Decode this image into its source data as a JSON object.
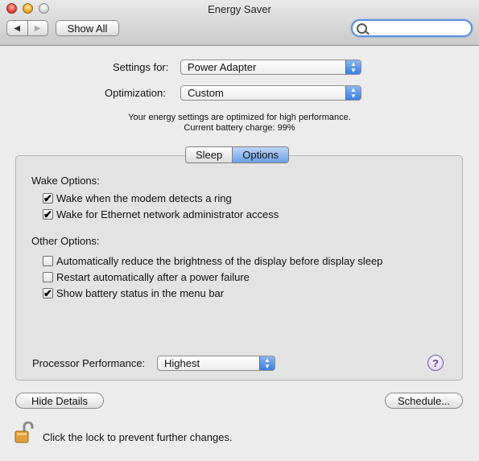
{
  "window": {
    "title": "Energy Saver"
  },
  "toolbar": {
    "show_all_label": "Show All",
    "back_glyph": "◀",
    "forward_glyph": "▶",
    "search_placeholder": ""
  },
  "settings": {
    "settings_for_label": "Settings for:",
    "settings_for_value": "Power Adapter",
    "optimization_label": "Optimization:",
    "optimization_value": "Custom",
    "note_line1": "Your energy settings are optimized for high performance.",
    "note_line2": "Current battery charge: 99%"
  },
  "tabs": [
    {
      "label": "Sleep",
      "active": false
    },
    {
      "label": "Options",
      "active": true
    }
  ],
  "wake_options": {
    "heading": "Wake Options:",
    "items": [
      {
        "label": "Wake when the modem detects a ring",
        "checked": true
      },
      {
        "label": "Wake for Ethernet network administrator access",
        "checked": true
      }
    ]
  },
  "other_options": {
    "heading": "Other Options:",
    "items": [
      {
        "label": "Automatically reduce the brightness of the display before display sleep",
        "checked": false
      },
      {
        "label": "Restart automatically after a power failure",
        "checked": false
      },
      {
        "label": "Show battery status in the menu bar",
        "checked": true
      }
    ]
  },
  "processor": {
    "label": "Processor Performance:",
    "value": "Highest"
  },
  "help": {
    "glyph": "?"
  },
  "buttons": {
    "hide_details": "Hide Details",
    "schedule": "Schedule..."
  },
  "lock": {
    "text": "Click the lock to prevent further changes.",
    "icon": "lock-open-icon"
  },
  "checkmark": "✔",
  "popup_arrows": {
    "up": "▲",
    "down": "▼"
  }
}
